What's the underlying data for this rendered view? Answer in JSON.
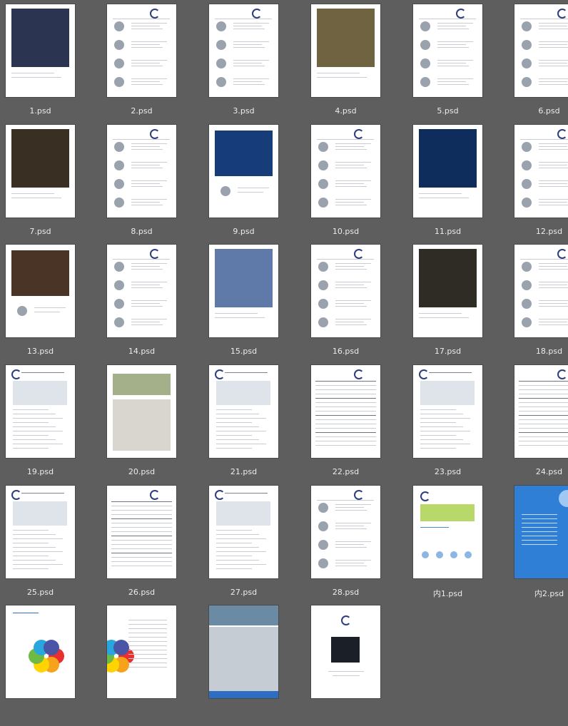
{
  "files": [
    {
      "name": "1.psd",
      "kind": "photo",
      "tone": "#2b3552"
    },
    {
      "name": "2.psd",
      "kind": "catalog"
    },
    {
      "name": "3.psd",
      "kind": "catalog"
    },
    {
      "name": "4.psd",
      "kind": "photo",
      "tone": "#6f6342"
    },
    {
      "name": "5.psd",
      "kind": "catalog"
    },
    {
      "name": "6.psd",
      "kind": "catalog"
    },
    {
      "name": "7.psd",
      "kind": "photo",
      "tone": "#3a2f23"
    },
    {
      "name": "8.psd",
      "kind": "catalog"
    },
    {
      "name": "9.psd",
      "kind": "photo-top",
      "tone": "#173c7a"
    },
    {
      "name": "10.psd",
      "kind": "catalog"
    },
    {
      "name": "11.psd",
      "kind": "photo",
      "tone": "#0e2d5c"
    },
    {
      "name": "12.psd",
      "kind": "catalog"
    },
    {
      "name": "13.psd",
      "kind": "photo-top",
      "tone": "#4a3425"
    },
    {
      "name": "14.psd",
      "kind": "catalog"
    },
    {
      "name": "15.psd",
      "kind": "photo",
      "tone": "#5f79a8"
    },
    {
      "name": "16.psd",
      "kind": "catalog"
    },
    {
      "name": "17.psd",
      "kind": "photo",
      "tone": "#2e2c24"
    },
    {
      "name": "18.psd",
      "kind": "catalog"
    },
    {
      "name": "19.psd",
      "kind": "spec"
    },
    {
      "name": "20.psd",
      "kind": "photo-bottom",
      "tone": "#d8d6cf"
    },
    {
      "name": "21.psd",
      "kind": "spec"
    },
    {
      "name": "22.psd",
      "kind": "table"
    },
    {
      "name": "23.psd",
      "kind": "spec"
    },
    {
      "name": "24.psd",
      "kind": "table"
    },
    {
      "name": "25.psd",
      "kind": "spec"
    },
    {
      "name": "26.psd",
      "kind": "table"
    },
    {
      "name": "27.psd",
      "kind": "spec"
    },
    {
      "name": "28.psd",
      "kind": "catalog"
    },
    {
      "name": "内1.psd",
      "kind": "leaf"
    },
    {
      "name": "内2.psd",
      "kind": "blue"
    },
    {
      "name": "",
      "kind": "flower"
    },
    {
      "name": "",
      "kind": "flower-half"
    },
    {
      "name": "",
      "kind": "building"
    },
    {
      "name": "",
      "kind": "cover-back"
    }
  ]
}
